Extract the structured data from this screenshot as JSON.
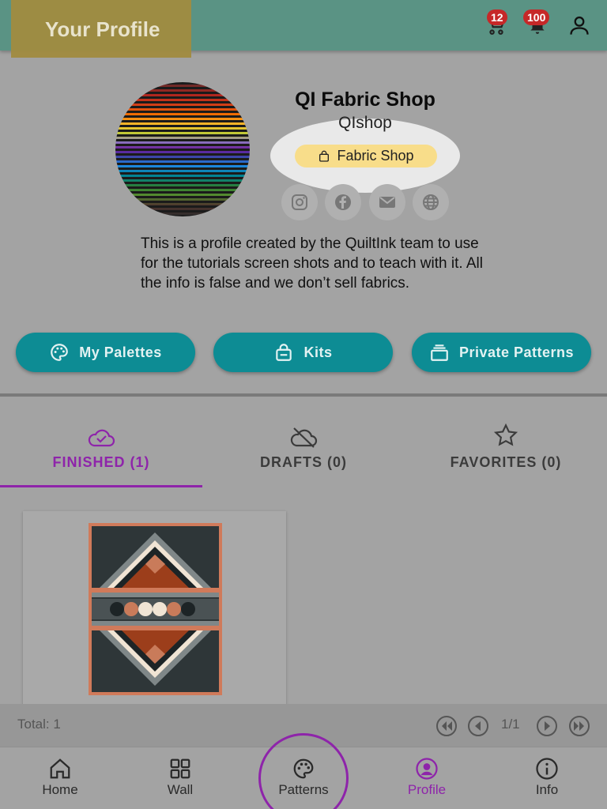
{
  "header": {
    "title": "Your Profile",
    "cart_count": "12",
    "notifications_count": "100"
  },
  "profile": {
    "shop_name": "QI Fabric Shop",
    "handle": "QIshop",
    "type_label": "Fabric Shop",
    "bio": "This is a profile created by the QuiltInk team to use for the tutorials screen shots and to teach with it. All the info is false and we don’t sell fabrics.",
    "social_icons": [
      "instagram-icon",
      "facebook-icon",
      "email-icon",
      "website-icon"
    ]
  },
  "actions": {
    "my_palettes": "My Palettes",
    "kits": "Kits",
    "private_patterns": "Private Patterns"
  },
  "tabs": [
    {
      "label": "FINISHED (1)",
      "icon": "cloud-check-icon",
      "active": true
    },
    {
      "label": "DRAFTS (0)",
      "icon": "cloud-off-icon",
      "active": false
    },
    {
      "label": "FAVORITES (0)",
      "icon": "star-icon",
      "active": false
    }
  ],
  "pagination": {
    "total": "Total: 1",
    "page": "1/1"
  },
  "nav": [
    {
      "label": "Home",
      "icon": "home-icon"
    },
    {
      "label": "Wall",
      "icon": "grid-icon"
    },
    {
      "label": "Patterns",
      "icon": "palette-icon"
    },
    {
      "label": "Profile",
      "icon": "profile-icon",
      "active": true
    },
    {
      "label": "Info",
      "icon": "info-icon"
    }
  ],
  "colors": {
    "header": "#5a9384",
    "accent": "#0d8c94",
    "active": "#8e24aa",
    "chip": "#f8dd8a"
  }
}
